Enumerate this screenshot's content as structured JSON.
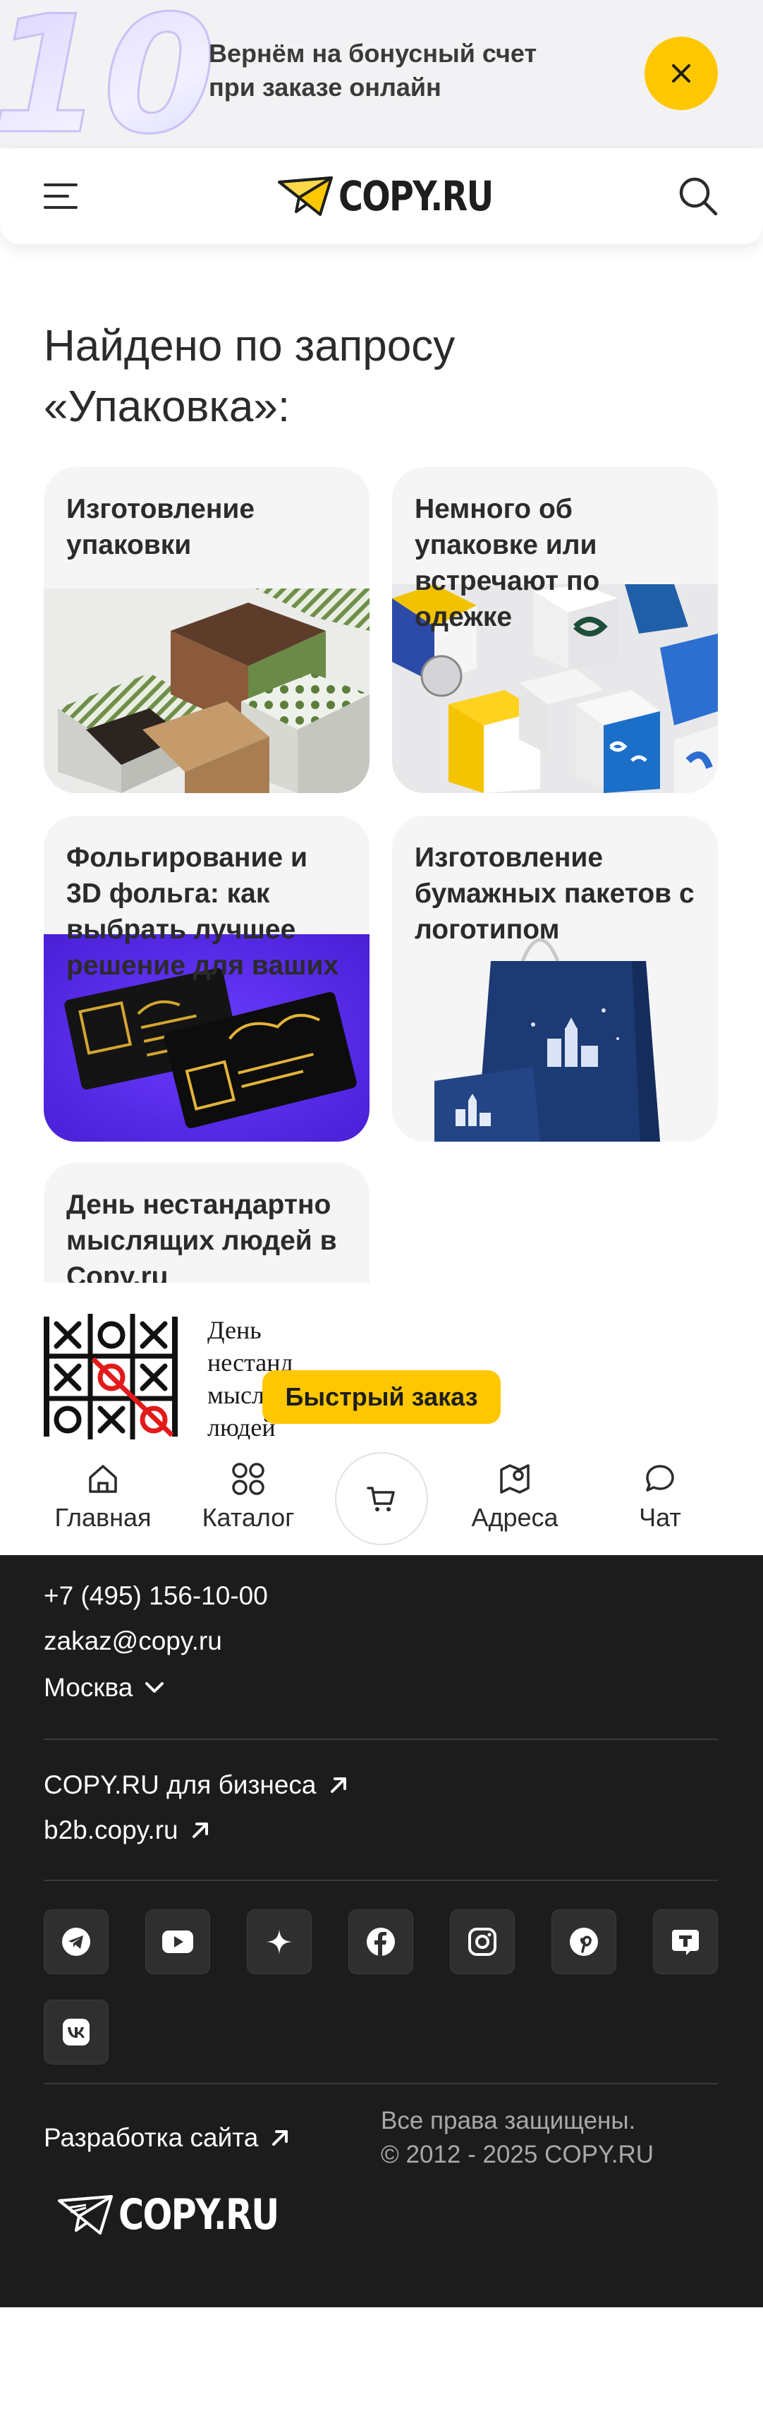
{
  "promo": {
    "line1": "Вернём на бонусный счет",
    "line2": "при заказе онлайн",
    "art_text": "10%",
    "close_icon": "close-icon",
    "close_color": "#ffc700"
  },
  "header": {
    "logo_text": "COPY.RU",
    "menu_icon": "hamburger-icon",
    "search_icon": "search-icon"
  },
  "search": {
    "heading_line1": "Найдено по запросу",
    "heading_line2": "«Упаковка»:"
  },
  "results": [
    {
      "title": "Изготовление упаковки"
    },
    {
      "title": "Немного об упаковке или встречают по одежке"
    },
    {
      "title": "Фольгирование и 3D фольга: как выбрать лучшее решение для ваших"
    },
    {
      "title": "Изготовление бумажных пакетов с логотипом"
    },
    {
      "title": "День нестандартно мыслящих людей в Copy.ru"
    }
  ],
  "ad": {
    "text": "День нестандартно мыслящих людей"
  },
  "quick_order": {
    "label": "Быстрый заказ"
  },
  "bottom_nav": {
    "items": [
      {
        "label": "Главная",
        "icon": "home-icon"
      },
      {
        "label": "Каталог",
        "icon": "catalog-icon"
      },
      {
        "label": "Адреса",
        "icon": "map-icon"
      },
      {
        "label": "Чат",
        "icon": "chat-icon"
      }
    ],
    "cart_icon": "cart-icon"
  },
  "footer": {
    "phone": "+7 (495) 156-10-00",
    "email": "zakaz@copy.ru",
    "city": "Москва",
    "business_link": "COPY.RU для бизнеса",
    "b2b_link": "b2b.copy.ru",
    "social": [
      "telegram-icon",
      "youtube-icon",
      "dzen-icon",
      "facebook-icon",
      "instagram-icon",
      "pinterest-icon",
      "tenchat-icon",
      "vk-icon"
    ],
    "dev_link": "Разработка сайта",
    "rights_line1": "Все права защищены.",
    "rights_line2": "© 2012 - 2025 COPY.RU",
    "logo_text": "COPY.RU"
  },
  "colors": {
    "accent": "#ffc700",
    "footer_bg": "#1c1c1c",
    "card_bg": "#f5f5f6"
  }
}
